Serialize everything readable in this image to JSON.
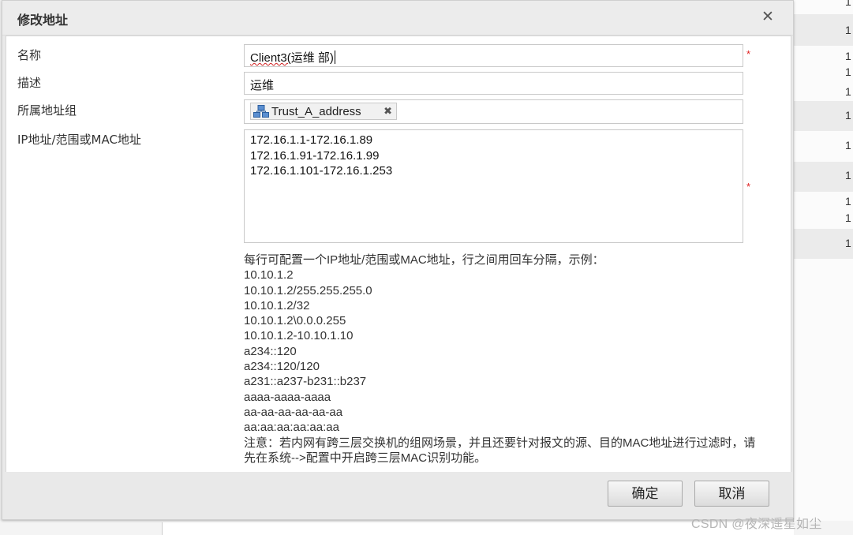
{
  "dialog": {
    "title": "修改地址",
    "close_glyph": "✕",
    "fields": {
      "name": {
        "label": "名称",
        "value_main": "Client3(",
        "value_rest": "运维 部)",
        "required_mark": "*"
      },
      "description": {
        "label": "描述",
        "value": "运维"
      },
      "address_group": {
        "label": "所属地址组",
        "tag": "Trust_A_address",
        "tag_icon": "network-group-icon",
        "tag_remove": "✖"
      },
      "ip": {
        "label": "IP地址/范围或MAC地址",
        "lines": [
          "172.16.1.1-172.16.1.89",
          "172.16.1.91-172.16.1.99",
          "172.16.1.101-172.16.1.253"
        ],
        "required_mark": "*"
      }
    },
    "help": {
      "intro": "每行可配置一个IP地址/范围或MAC地址，行之间用回车分隔，示例：",
      "examples": [
        "10.10.1.2",
        "10.10.1.2/255.255.255.0",
        "10.10.1.2/32",
        "10.10.1.2\\0.0.0.255",
        "10.10.1.2-10.10.1.10",
        "a234::120",
        "a234::120/120",
        "a231::a237-b231::b237",
        "aaaa-aaaa-aaaa",
        "aa-aa-aa-aa-aa-aa",
        "aa:aa:aa:aa:aa:aa"
      ],
      "note": "注意：若内网有跨三层交换机的组网场景，并且还要针对报文的源、目的MAC地址进行过滤时，请先在系统-->配置中开启跨三层MAC识别功能。"
    },
    "buttons": {
      "ok": "确定",
      "cancel": "取消"
    }
  },
  "background": {
    "row_digits": [
      "1",
      "1",
      "1",
      "1",
      "1",
      "1",
      "1",
      "1",
      "1",
      "1",
      "1"
    ]
  },
  "watermark": "CSDN @夜深遥星如尘"
}
